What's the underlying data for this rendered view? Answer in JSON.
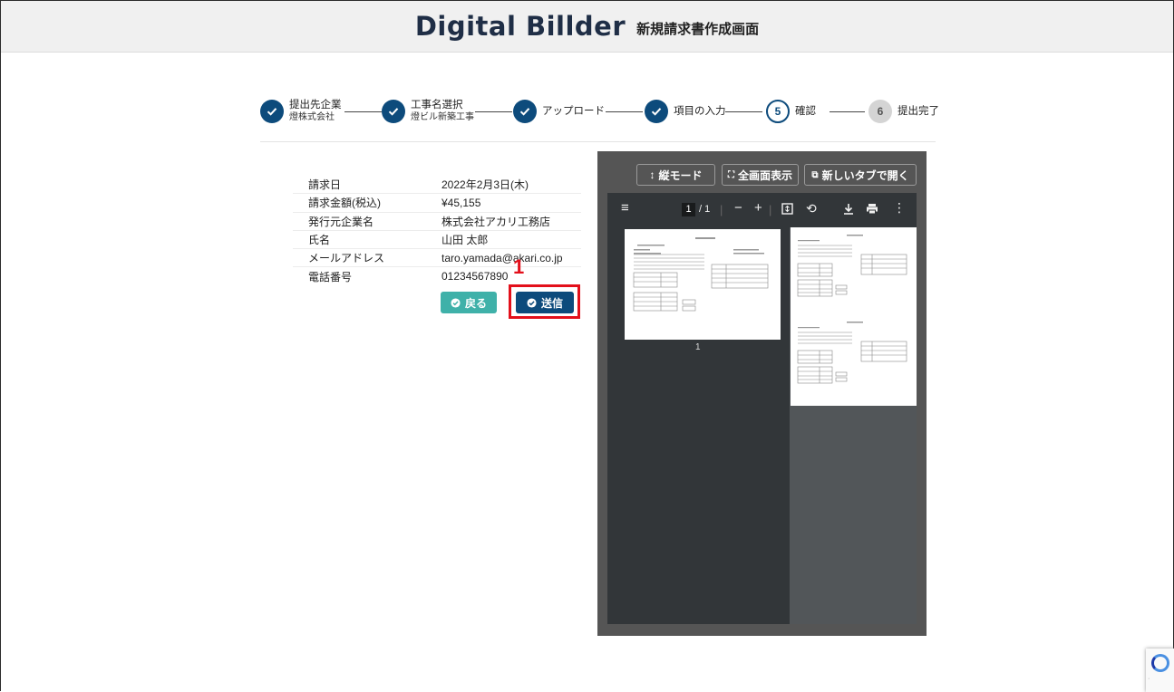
{
  "header": {
    "logo": "Digital Billder",
    "title": "新規請求書作成画面"
  },
  "stepper": {
    "steps": [
      {
        "label": "提出先企業",
        "sub": "燈株式会社",
        "state": "done"
      },
      {
        "label": "工事名選択",
        "sub": "燈ビル新築工事",
        "state": "done"
      },
      {
        "label": "アップロード",
        "sub": "",
        "state": "done"
      },
      {
        "label": "項目の入力",
        "sub": "",
        "state": "done"
      },
      {
        "label": "確認",
        "number": "5",
        "state": "current"
      },
      {
        "label": "提出完了",
        "number": "6",
        "state": "todo"
      }
    ]
  },
  "summary": {
    "rows": [
      {
        "key": "請求日",
        "value": "2022年2月3日(木)"
      },
      {
        "key": "請求金額(税込)",
        "value": "¥45,155"
      },
      {
        "key": "発行元企業名",
        "value": "株式会社アカリ工務店"
      },
      {
        "key": "氏名",
        "value": "山田 太郎"
      },
      {
        "key": "メールアドレス",
        "value": "taro.yamada@akari.co.jp"
      },
      {
        "key": "電話番号",
        "value": "01234567890"
      }
    ],
    "back_label": "戻る",
    "send_label": "送信"
  },
  "annotation": {
    "number": "1",
    "color": "#e3101b"
  },
  "viewer": {
    "portrait_mode": "縦モード",
    "fullscreen": "全画面表示",
    "new_tab": "新しいタブで開く",
    "page_current": "1",
    "page_total": "/ 1",
    "zoom_out": "−",
    "zoom_in": "+",
    "thumb_page_number": "1"
  },
  "colors": {
    "primary": "#0d4b7c",
    "teal": "#3fb1a9",
    "highlight": "#e3101b"
  },
  "icons": [
    "check-icon",
    "menu-icon",
    "fit-page-icon",
    "rotate-icon",
    "download-icon",
    "print-icon",
    "more-icon",
    "expand-icon",
    "external-link-icon",
    "vertical-arrow-icon",
    "recaptcha-icon"
  ]
}
